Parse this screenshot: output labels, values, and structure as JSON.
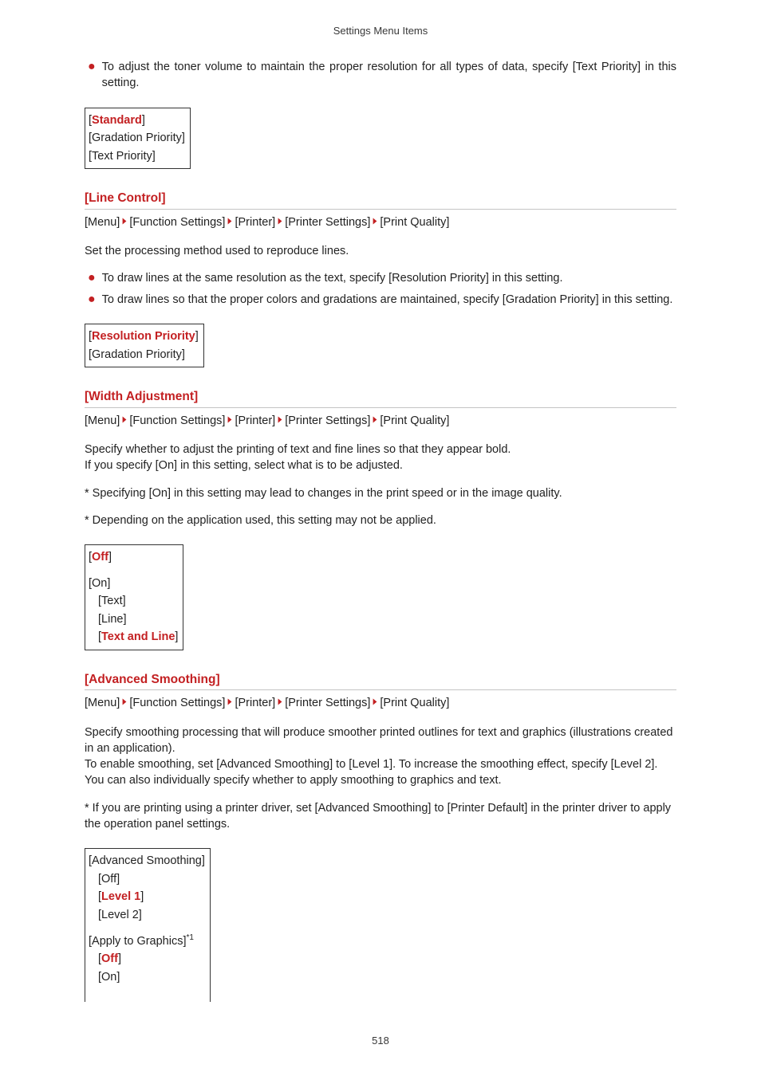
{
  "pageHeader": "Settings Menu Items",
  "pageNumber": "518",
  "intro": {
    "bullets": [
      "To adjust the toner volume to maintain the proper resolution for all types of data, specify [Text Priority] in this setting."
    ],
    "options": [
      {
        "text": "[Standard]",
        "default": true,
        "indent": 0
      },
      {
        "text": "[Gradation Priority]",
        "default": false,
        "indent": 0
      },
      {
        "text": "[Text Priority]",
        "default": false,
        "indent": 0
      }
    ]
  },
  "sections": [
    {
      "title": "[Line Control]",
      "crumbs": [
        "[Menu]",
        "[Function Settings]",
        "[Printer]",
        "[Printer Settings]",
        "[Print Quality]"
      ],
      "paragraphs": [
        "Set the processing method used to reproduce lines."
      ],
      "bullets": [
        "To draw lines at the same resolution as the text, specify [Resolution Priority] in this setting.",
        "To draw lines so that the proper colors and gradations are maintained, specify [Gradation Priority] in this setting."
      ],
      "options": [
        {
          "text": "[Resolution Priority]",
          "default": true,
          "indent": 0
        },
        {
          "text": "[Gradation Priority]",
          "default": false,
          "indent": 0
        }
      ]
    },
    {
      "title": "[Width Adjustment]",
      "crumbs": [
        "[Menu]",
        "[Function Settings]",
        "[Printer]",
        "[Printer Settings]",
        "[Print Quality]"
      ],
      "paragraphs": [
        "Specify whether to adjust the printing of text and fine lines so that they appear bold.\nIf you specify [On] in this setting, select what is to be adjusted.",
        "* Specifying [On] in this setting may lead to changes in the print speed or in the image quality.",
        "* Depending on the application used, this setting may not be applied."
      ],
      "options": [
        {
          "text": "[Off]",
          "default": true,
          "indent": 0,
          "group": 0
        },
        {
          "text": "[On]",
          "default": false,
          "indent": 0,
          "group": 1
        },
        {
          "text": "[Text]",
          "default": false,
          "indent": 1,
          "group": 1
        },
        {
          "text": "[Line]",
          "default": false,
          "indent": 1,
          "group": 1
        },
        {
          "text": "[Text and Line]",
          "default": true,
          "indent": 1,
          "group": 1
        }
      ]
    },
    {
      "title": "[Advanced Smoothing]",
      "crumbs": [
        "[Menu]",
        "[Function Settings]",
        "[Printer]",
        "[Printer Settings]",
        "[Print Quality]"
      ],
      "paragraphs": [
        "Specify smoothing processing that will produce smoother printed outlines for text and graphics (illustrations created in an application).\nTo enable smoothing, set [Advanced Smoothing] to [Level 1]. To increase the smoothing effect, specify [Level 2]. You can also individually specify whether to apply smoothing to graphics and text.",
        "* If you are printing using a printer driver, set [Advanced Smoothing] to [Printer Default] in the printer driver to apply the operation panel settings."
      ],
      "options": [
        {
          "text": "[Advanced Smoothing]",
          "default": false,
          "indent": 0,
          "group": 0
        },
        {
          "text": "[Off]",
          "default": false,
          "indent": 1,
          "group": 0
        },
        {
          "text": "[Level 1]",
          "default": true,
          "indent": 1,
          "group": 0
        },
        {
          "text": "[Level 2]",
          "default": false,
          "indent": 1,
          "group": 0
        },
        {
          "text": "[Apply to Graphics]",
          "sup": "*1",
          "default": false,
          "indent": 0,
          "group": 1
        },
        {
          "text": "[Off]",
          "default": true,
          "indent": 1,
          "group": 1
        },
        {
          "text": "[On]",
          "default": false,
          "indent": 1,
          "group": 1
        }
      ],
      "openBottom": true
    }
  ]
}
